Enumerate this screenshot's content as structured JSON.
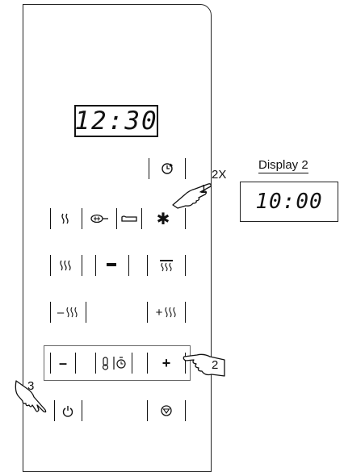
{
  "display_main": "12:30",
  "display2": {
    "title": "Display  2",
    "value": "10:00"
  },
  "labels": {
    "step1": "1",
    "step1_count": "2X",
    "step2": "2",
    "step3": "3"
  },
  "buttons": {
    "minus": "–",
    "plus": "+",
    "minus_heat": "–",
    "plus_heat": "+",
    "minus_heat_symbol": "ꟹ",
    "plus_heat_symbol": "ꟹ"
  }
}
